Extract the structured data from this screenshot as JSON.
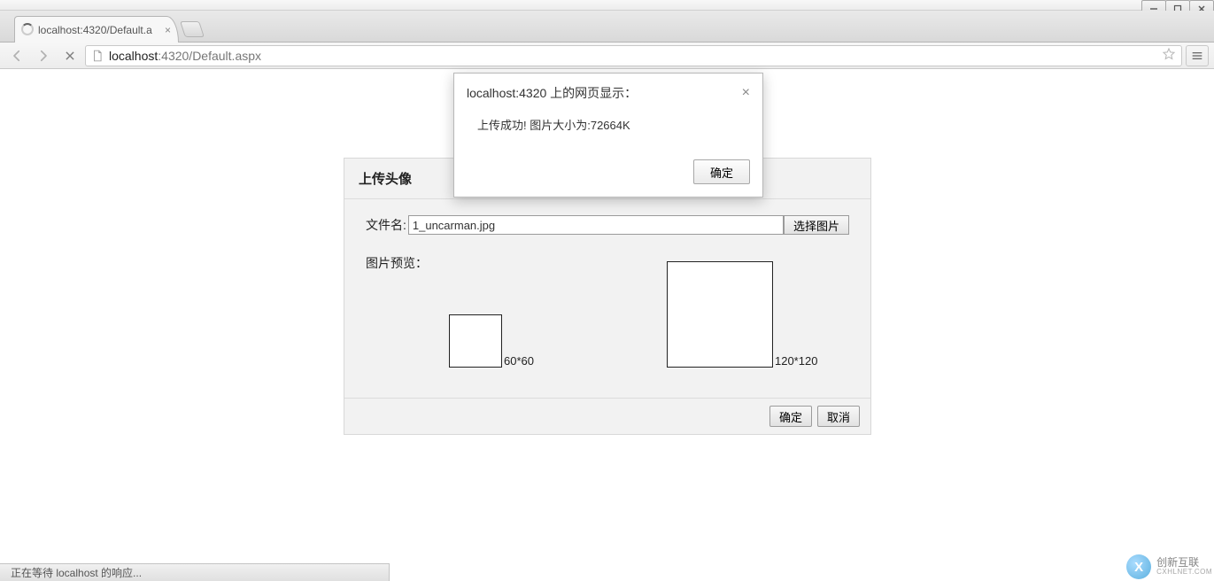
{
  "window": {
    "minimize": "—",
    "maximize": "☐",
    "close": "✕"
  },
  "tab": {
    "title": "localhost:4320/Default.a",
    "close": "×"
  },
  "url": {
    "host": "localhost",
    "rest": ":4320/Default.aspx"
  },
  "alert": {
    "title": "localhost:4320 上的网页显示：",
    "message": "上传成功! 图片大小为:72664K",
    "ok": "确定"
  },
  "panel": {
    "title": "上传头像",
    "filename_label": "文件名:",
    "filename_value": "1_uncarman.jpg",
    "select_btn": "选择图片",
    "preview_label": "图片预览：",
    "size_small": "60*60",
    "size_large": "120*120",
    "confirm": "确定",
    "cancel": "取消"
  },
  "status": {
    "text": "正在等待 localhost 的响应..."
  },
  "watermark": {
    "brand": "创新互联",
    "sub": "CXHLNET.COM"
  }
}
